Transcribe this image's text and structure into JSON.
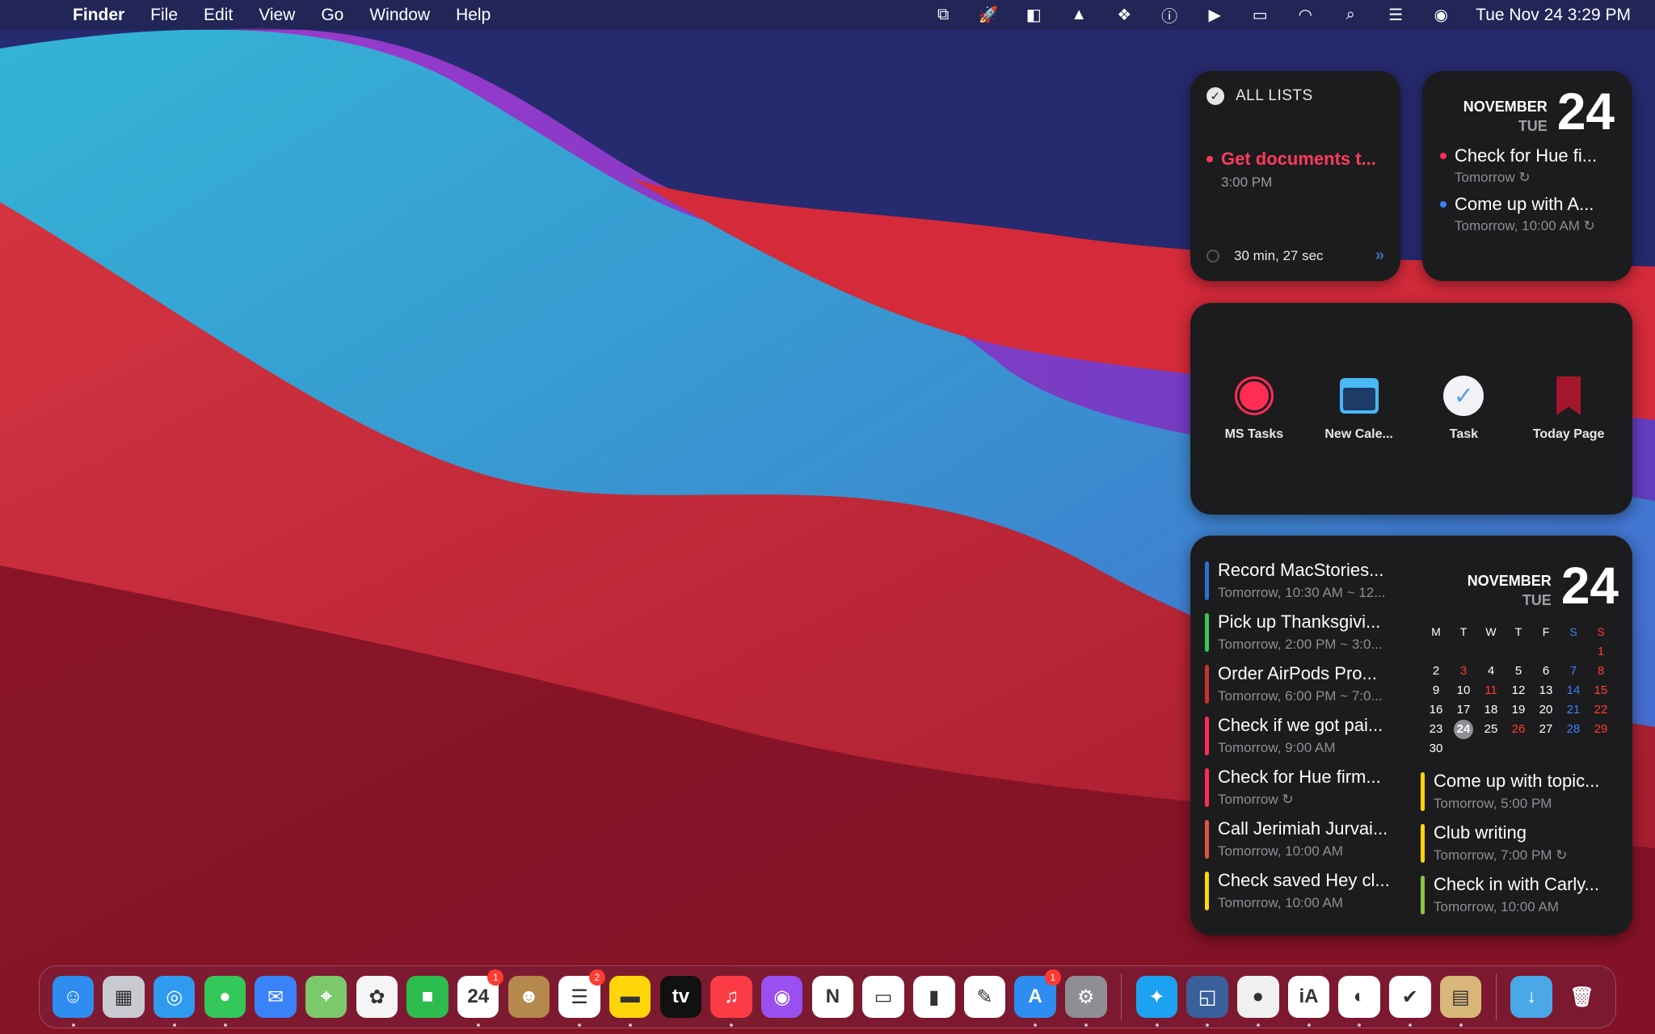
{
  "menubar": {
    "app_name": "Finder",
    "menus": [
      "File",
      "Edit",
      "View",
      "Go",
      "Window",
      "Help"
    ],
    "status_icons": [
      "screen-share-icon",
      "rocket-icon",
      "toggle-icon",
      "hat-icon",
      "dropbox-icon",
      "onepassword-icon",
      "play-icon",
      "battery-icon",
      "wifi-icon",
      "search-icon",
      "control-center-icon",
      "siri-icon"
    ],
    "clock": "Tue Nov 24  3:29 PM"
  },
  "lists_widget": {
    "header": "ALL LISTS",
    "task_title": "Get documents t...",
    "task_time": "3:00 PM",
    "timer": "30 min, 27 sec",
    "accent": "#ff3b5c"
  },
  "calendar_small": {
    "month": "NOVEMBER",
    "weekday": "TUE",
    "day": "24",
    "events": [
      {
        "title": "Check for Hue fi...",
        "sub": "Tomorrow ↻",
        "color": "#ff2d55"
      },
      {
        "title": "Come up with A...",
        "sub": "Tomorrow, 10:00 AM ↻",
        "color": "#3a82f7"
      }
    ]
  },
  "launcher": {
    "items": [
      {
        "label": "MS Tasks",
        "icon": "record-icon"
      },
      {
        "label": "New Cale...",
        "icon": "calendar-icon"
      },
      {
        "label": "Task",
        "icon": "checkmark-icon"
      },
      {
        "label": "Today Page",
        "icon": "bookmark-icon"
      }
    ]
  },
  "calendar_big": {
    "month": "NOVEMBER",
    "weekday": "TUE",
    "day": "24",
    "weekday_headers": [
      "M",
      "T",
      "W",
      "T",
      "F",
      "S",
      "S"
    ],
    "weeks": [
      [
        "",
        "",
        "",
        "",
        "",
        "",
        "1"
      ],
      [
        "2",
        "3",
        "4",
        "5",
        "6",
        "7",
        "8"
      ],
      [
        "9",
        "10",
        "11",
        "12",
        "13",
        "14",
        "15"
      ],
      [
        "16",
        "17",
        "18",
        "19",
        "20",
        "21",
        "22"
      ],
      [
        "23",
        "24",
        "25",
        "26",
        "27",
        "28",
        "29"
      ],
      [
        "30",
        "",
        "",
        "",
        "",
        "",
        ""
      ]
    ],
    "left_events": [
      {
        "title": "Record MacStories...",
        "sub": "Tomorrow, 10:30 AM ~ 12...",
        "color": "#2f6fd6"
      },
      {
        "title": "Pick up Thanksgivi...",
        "sub": "Tomorrow, 2:00 PM ~ 3:0...",
        "color": "#34c759"
      },
      {
        "title": "Order AirPods Pro...",
        "sub": "Tomorrow, 6:00 PM ~ 7:0...",
        "color": "#c9302c"
      },
      {
        "title": "Check if we got pai...",
        "sub": "Tomorrow, 9:00 AM",
        "color": "#ff2d55"
      },
      {
        "title": "Check for Hue firm...",
        "sub": "Tomorrow ↻",
        "color": "#ff2d55"
      },
      {
        "title": "Call Jerimiah Jurvai...",
        "sub": "Tomorrow, 10:00 AM",
        "color": "#e0533f"
      },
      {
        "title": "Check saved Hey cl...",
        "sub": "Tomorrow, 10:00 AM",
        "color": "#ffd60a"
      }
    ],
    "right_events": [
      {
        "title": "Come up with topic...",
        "sub": "Tomorrow, 5:00 PM",
        "color": "#ffd60a"
      },
      {
        "title": "Club writing",
        "sub": "Tomorrow, 7:00 PM ↻",
        "color": "#ffd60a"
      },
      {
        "title": "Check in with Carly...",
        "sub": "Tomorrow, 10:00 AM",
        "color": "#8bc34a"
      }
    ]
  },
  "dock": {
    "apps": [
      {
        "name": "finder-icon",
        "glyph": "☺",
        "bg": "#2f8cf0",
        "run": true
      },
      {
        "name": "launchpad-icon",
        "glyph": "▦",
        "bg": "#c9c9d1",
        "run": false
      },
      {
        "name": "safari-icon",
        "glyph": "◎",
        "bg": "#2f9bf0",
        "run": true
      },
      {
        "name": "messages-icon",
        "glyph": "●",
        "bg": "#34c759",
        "run": true
      },
      {
        "name": "mail-icon",
        "glyph": "✉",
        "bg": "#3a82f7",
        "run": false
      },
      {
        "name": "maps-icon",
        "glyph": "⌖",
        "bg": "#7cc96b",
        "run": false
      },
      {
        "name": "photos-icon",
        "glyph": "✿",
        "bg": "#f5f5f5",
        "run": false
      },
      {
        "name": "facetime-icon",
        "glyph": "■",
        "bg": "#2dbd4e",
        "run": false
      },
      {
        "name": "calendar-app-icon",
        "glyph": "24",
        "bg": "#ffffff",
        "badge": "1",
        "run": true
      },
      {
        "name": "contacts-icon",
        "glyph": "☻",
        "bg": "#b5884d",
        "run": false
      },
      {
        "name": "reminders-icon",
        "glyph": "☰",
        "bg": "#ffffff",
        "badge": "2",
        "run": true
      },
      {
        "name": "notes-icon",
        "glyph": "▬",
        "bg": "#ffd60a",
        "run": true
      },
      {
        "name": "appletv-icon",
        "glyph": "tv",
        "bg": "#111111",
        "run": false
      },
      {
        "name": "music-icon",
        "glyph": "♫",
        "bg": "#fc3c44",
        "run": true
      },
      {
        "name": "podcasts-icon",
        "glyph": "◉",
        "bg": "#9a4ff0",
        "run": false
      },
      {
        "name": "news-icon",
        "glyph": "N",
        "bg": "#ffffff",
        "run": false
      },
      {
        "name": "keynote-icon",
        "glyph": "▭",
        "bg": "#ffffff",
        "run": false
      },
      {
        "name": "numbers-icon",
        "glyph": "▮",
        "bg": "#ffffff",
        "run": false
      },
      {
        "name": "pages-icon",
        "glyph": "✎",
        "bg": "#ffffff",
        "run": false
      },
      {
        "name": "appstore-icon",
        "glyph": "A",
        "bg": "#2f8cf0",
        "badge": "1",
        "run": true
      },
      {
        "name": "system-preferences-icon",
        "glyph": "⚙",
        "bg": "#8e8e93",
        "run": true
      },
      {
        "name": "sep",
        "glyph": ""
      },
      {
        "name": "twitter-icon",
        "glyph": "✦",
        "bg": "#1da1f2",
        "run": true
      },
      {
        "name": "screens-icon",
        "glyph": "◱",
        "bg": "#3a5f9a",
        "run": true
      },
      {
        "name": "github-icon",
        "glyph": "●",
        "bg": "#f0f0f0",
        "run": true
      },
      {
        "name": "ia-writer-icon",
        "glyph": "iA",
        "bg": "#ffffff",
        "run": true
      },
      {
        "name": "craft-icon",
        "glyph": "◐",
        "bg": "#ffffff",
        "run": true
      },
      {
        "name": "things-icon",
        "glyph": "✔",
        "bg": "#ffffff",
        "run": true
      },
      {
        "name": "mailplane-icon",
        "glyph": "▤",
        "bg": "#d9b77a",
        "run": true
      },
      {
        "name": "sep",
        "glyph": ""
      },
      {
        "name": "downloads-folder-icon",
        "glyph": "↓",
        "bg": "#4aa8e8",
        "run": false
      },
      {
        "name": "trash-icon",
        "glyph": "🗑",
        "bg": "transparent",
        "run": false
      }
    ]
  }
}
